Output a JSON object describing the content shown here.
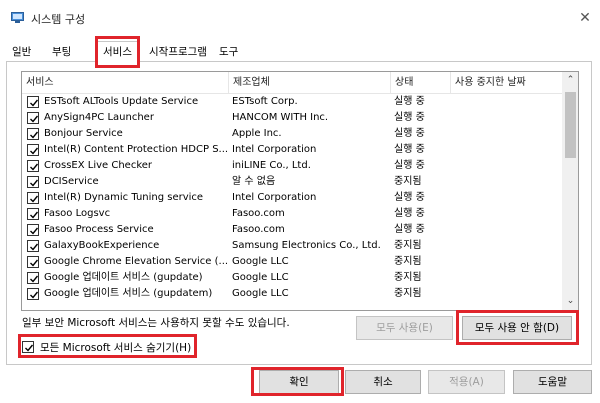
{
  "window": {
    "title": "시스템 구성",
    "icon": "system-config-icon",
    "close_glyph": "✕"
  },
  "tabs": [
    {
      "label": "일반",
      "active": false
    },
    {
      "label": "부팅",
      "active": false
    },
    {
      "label": "서비스",
      "active": true
    },
    {
      "label": "시작프로그램",
      "active": false
    },
    {
      "label": "도구",
      "active": false
    }
  ],
  "services": {
    "columns": [
      "서비스",
      "제조업체",
      "상태",
      "사용 중지한 날짜"
    ],
    "rows": [
      {
        "name": "ESTsoft ALTools Update Service",
        "maker": "ESTsoft Corp.",
        "status": "실행 중",
        "checked": true
      },
      {
        "name": "AnySign4PC Launcher",
        "maker": "HANCOM WITH Inc.",
        "status": "실행 중",
        "checked": true
      },
      {
        "name": "Bonjour Service",
        "maker": "Apple Inc.",
        "status": "실행 중",
        "checked": true
      },
      {
        "name": "Intel(R) Content Protection HDCP S...",
        "maker": "Intel Corporation",
        "status": "실행 중",
        "checked": true
      },
      {
        "name": "CrossEX Live Checker",
        "maker": "iniLINE Co., Ltd.",
        "status": "실행 중",
        "checked": true
      },
      {
        "name": "DCIService",
        "maker": "알 수 없음",
        "status": "중지됨",
        "checked": true
      },
      {
        "name": "Intel(R) Dynamic Tuning service",
        "maker": "Intel Corporation",
        "status": "실행 중",
        "checked": true
      },
      {
        "name": "Fasoo Logsvc",
        "maker": "Fasoo.com",
        "status": "실행 중",
        "checked": true
      },
      {
        "name": "Fasoo Process Service",
        "maker": "Fasoo.com",
        "status": "실행 중",
        "checked": true
      },
      {
        "name": "GalaxyBookExperience",
        "maker": "Samsung Electronics Co., Ltd.",
        "status": "중지됨",
        "checked": true
      },
      {
        "name": "Google Chrome Elevation Service (...",
        "maker": "Google LLC",
        "status": "중지됨",
        "checked": true
      },
      {
        "name": "Google 업데이트 서비스 (gupdate)",
        "maker": "Google LLC",
        "status": "중지됨",
        "checked": true
      },
      {
        "name": "Google 업데이트 서비스 (gupdatem)",
        "maker": "Google LLC",
        "status": "중지됨",
        "checked": true
      }
    ],
    "scroll_up": "⌃",
    "scroll_down": "⌄"
  },
  "note": "일부 보안 Microsoft 서비스는 사용하지 못할 수도 있습니다.",
  "buttons": {
    "enable_all": "모두 사용(E)",
    "disable_all": "모두 사용 안 함(D)",
    "ok": "확인",
    "cancel": "취소",
    "apply": "적용(A)",
    "help": "도움말"
  },
  "hide_ms": {
    "label": "모든 Microsoft 서비스 숨기기(H)",
    "checked": true
  },
  "colors": {
    "highlight": "#e0242b"
  }
}
